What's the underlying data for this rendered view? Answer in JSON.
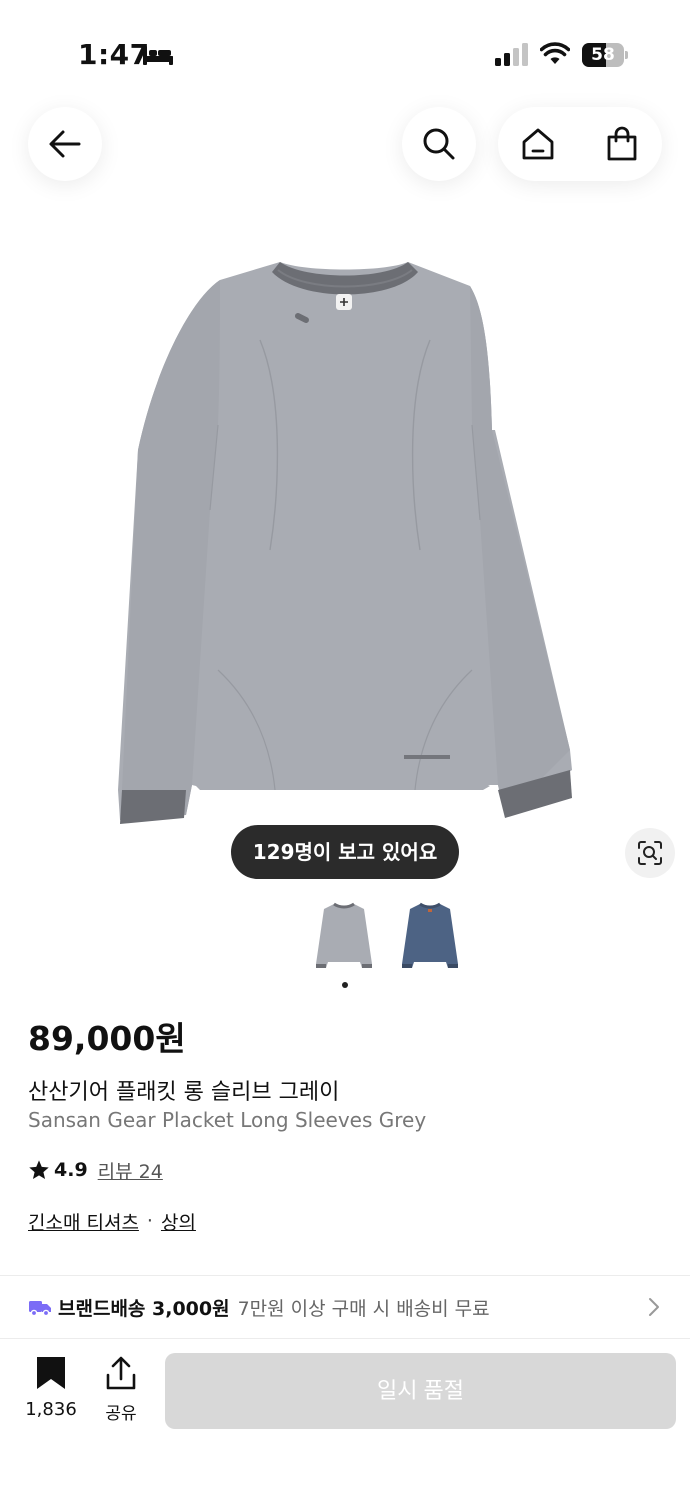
{
  "status_bar": {
    "time": "1:47",
    "battery_level": "58",
    "battery_fraction": 0.58
  },
  "nav": {
    "back_icon": "arrow-left-icon",
    "search_icon": "search-icon",
    "home_icon": "home-icon",
    "cart_icon": "shopping-bag-icon"
  },
  "gallery": {
    "viewer_badge": "129명이 보고 있어요",
    "lens_icon": "image-search-icon",
    "thumbnails": [
      {
        "color_name": "grey",
        "color": "#a9acb3"
      },
      {
        "color_name": "navy",
        "color": "#4d6384"
      }
    ],
    "active_index": 0
  },
  "product": {
    "price": "89,000원",
    "name_ko": "산산기어 플래킷 롱 슬리브 그레이",
    "name_en": "Sansan Gear Placket Long Sleeves Grey",
    "rating": "4.9",
    "review_label": "리뷰 24",
    "category_1": "긴소매 티셔츠",
    "category_sep": "·",
    "category_2": "상의"
  },
  "shipping": {
    "label": "브랜드배송 3,000원",
    "note": "7만원 이상 구매 시 배송비 무료",
    "icon": "truck-icon",
    "accent": "#7b6cf6"
  },
  "bottom_bar": {
    "like_count": "1,836",
    "share_label": "공유",
    "soldout_label": "일시 품절"
  }
}
